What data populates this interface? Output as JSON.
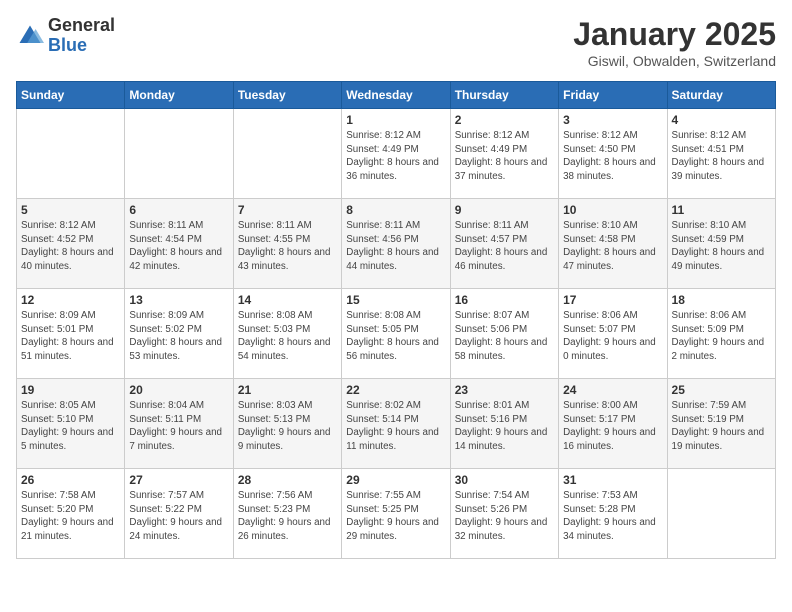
{
  "header": {
    "logo_general": "General",
    "logo_blue": "Blue",
    "month_title": "January 2025",
    "location": "Giswil, Obwalden, Switzerland"
  },
  "days_of_week": [
    "Sunday",
    "Monday",
    "Tuesday",
    "Wednesday",
    "Thursday",
    "Friday",
    "Saturday"
  ],
  "weeks": [
    [
      {
        "day": "",
        "info": ""
      },
      {
        "day": "",
        "info": ""
      },
      {
        "day": "",
        "info": ""
      },
      {
        "day": "1",
        "info": "Sunrise: 8:12 AM\nSunset: 4:49 PM\nDaylight: 8 hours and 36 minutes."
      },
      {
        "day": "2",
        "info": "Sunrise: 8:12 AM\nSunset: 4:49 PM\nDaylight: 8 hours and 37 minutes."
      },
      {
        "day": "3",
        "info": "Sunrise: 8:12 AM\nSunset: 4:50 PM\nDaylight: 8 hours and 38 minutes."
      },
      {
        "day": "4",
        "info": "Sunrise: 8:12 AM\nSunset: 4:51 PM\nDaylight: 8 hours and 39 minutes."
      }
    ],
    [
      {
        "day": "5",
        "info": "Sunrise: 8:12 AM\nSunset: 4:52 PM\nDaylight: 8 hours and 40 minutes."
      },
      {
        "day": "6",
        "info": "Sunrise: 8:11 AM\nSunset: 4:54 PM\nDaylight: 8 hours and 42 minutes."
      },
      {
        "day": "7",
        "info": "Sunrise: 8:11 AM\nSunset: 4:55 PM\nDaylight: 8 hours and 43 minutes."
      },
      {
        "day": "8",
        "info": "Sunrise: 8:11 AM\nSunset: 4:56 PM\nDaylight: 8 hours and 44 minutes."
      },
      {
        "day": "9",
        "info": "Sunrise: 8:11 AM\nSunset: 4:57 PM\nDaylight: 8 hours and 46 minutes."
      },
      {
        "day": "10",
        "info": "Sunrise: 8:10 AM\nSunset: 4:58 PM\nDaylight: 8 hours and 47 minutes."
      },
      {
        "day": "11",
        "info": "Sunrise: 8:10 AM\nSunset: 4:59 PM\nDaylight: 8 hours and 49 minutes."
      }
    ],
    [
      {
        "day": "12",
        "info": "Sunrise: 8:09 AM\nSunset: 5:01 PM\nDaylight: 8 hours and 51 minutes."
      },
      {
        "day": "13",
        "info": "Sunrise: 8:09 AM\nSunset: 5:02 PM\nDaylight: 8 hours and 53 minutes."
      },
      {
        "day": "14",
        "info": "Sunrise: 8:08 AM\nSunset: 5:03 PM\nDaylight: 8 hours and 54 minutes."
      },
      {
        "day": "15",
        "info": "Sunrise: 8:08 AM\nSunset: 5:05 PM\nDaylight: 8 hours and 56 minutes."
      },
      {
        "day": "16",
        "info": "Sunrise: 8:07 AM\nSunset: 5:06 PM\nDaylight: 8 hours and 58 minutes."
      },
      {
        "day": "17",
        "info": "Sunrise: 8:06 AM\nSunset: 5:07 PM\nDaylight: 9 hours and 0 minutes."
      },
      {
        "day": "18",
        "info": "Sunrise: 8:06 AM\nSunset: 5:09 PM\nDaylight: 9 hours and 2 minutes."
      }
    ],
    [
      {
        "day": "19",
        "info": "Sunrise: 8:05 AM\nSunset: 5:10 PM\nDaylight: 9 hours and 5 minutes."
      },
      {
        "day": "20",
        "info": "Sunrise: 8:04 AM\nSunset: 5:11 PM\nDaylight: 9 hours and 7 minutes."
      },
      {
        "day": "21",
        "info": "Sunrise: 8:03 AM\nSunset: 5:13 PM\nDaylight: 9 hours and 9 minutes."
      },
      {
        "day": "22",
        "info": "Sunrise: 8:02 AM\nSunset: 5:14 PM\nDaylight: 9 hours and 11 minutes."
      },
      {
        "day": "23",
        "info": "Sunrise: 8:01 AM\nSunset: 5:16 PM\nDaylight: 9 hours and 14 minutes."
      },
      {
        "day": "24",
        "info": "Sunrise: 8:00 AM\nSunset: 5:17 PM\nDaylight: 9 hours and 16 minutes."
      },
      {
        "day": "25",
        "info": "Sunrise: 7:59 AM\nSunset: 5:19 PM\nDaylight: 9 hours and 19 minutes."
      }
    ],
    [
      {
        "day": "26",
        "info": "Sunrise: 7:58 AM\nSunset: 5:20 PM\nDaylight: 9 hours and 21 minutes."
      },
      {
        "day": "27",
        "info": "Sunrise: 7:57 AM\nSunset: 5:22 PM\nDaylight: 9 hours and 24 minutes."
      },
      {
        "day": "28",
        "info": "Sunrise: 7:56 AM\nSunset: 5:23 PM\nDaylight: 9 hours and 26 minutes."
      },
      {
        "day": "29",
        "info": "Sunrise: 7:55 AM\nSunset: 5:25 PM\nDaylight: 9 hours and 29 minutes."
      },
      {
        "day": "30",
        "info": "Sunrise: 7:54 AM\nSunset: 5:26 PM\nDaylight: 9 hours and 32 minutes."
      },
      {
        "day": "31",
        "info": "Sunrise: 7:53 AM\nSunset: 5:28 PM\nDaylight: 9 hours and 34 minutes."
      },
      {
        "day": "",
        "info": ""
      }
    ]
  ]
}
